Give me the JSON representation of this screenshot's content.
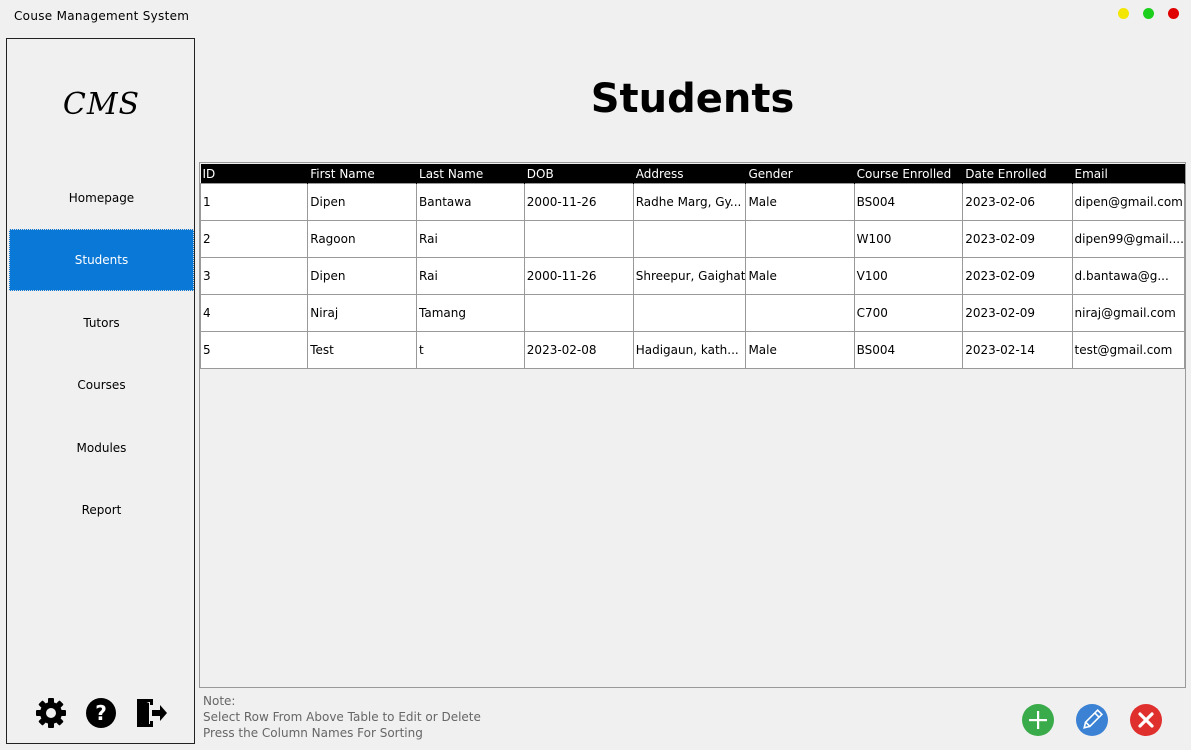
{
  "window": {
    "title": "Couse Management System"
  },
  "sidebar": {
    "logo": "CMS",
    "items": [
      {
        "label": "Homepage"
      },
      {
        "label": "Students",
        "active": true
      },
      {
        "label": "Tutors"
      },
      {
        "label": "Courses"
      },
      {
        "label": "Modules"
      },
      {
        "label": "Report"
      }
    ],
    "bottom_icons": [
      "gear-icon",
      "help-icon",
      "logout-icon"
    ]
  },
  "main": {
    "title": "Students",
    "table": {
      "columns": [
        "ID",
        "First Name",
        "Last Name",
        "DOB",
        "Address",
        "Gender",
        "Course Enrolled",
        "Date Enrolled",
        "Email"
      ],
      "rows": [
        [
          "1",
          "Dipen",
          "Bantawa",
          "2000-11-26",
          "Radhe Marg, Gy...",
          "Male",
          "BS004",
          "2023-02-06",
          "dipen@gmail.com"
        ],
        [
          "2",
          "Ragoon",
          "Rai",
          "",
          "",
          "",
          "W100",
          "2023-02-09",
          "dipen99@gmail...."
        ],
        [
          "3",
          "Dipen",
          "Rai",
          "2000-11-26",
          "Shreepur, Gaighat",
          "Male",
          "V100",
          "2023-02-09",
          "d.bantawa@g..."
        ],
        [
          "4",
          "Niraj",
          "Tamang",
          "",
          "",
          "",
          "C700",
          "2023-02-09",
          "niraj@gmail.com"
        ],
        [
          "5",
          "Test",
          "t",
          "2023-02-08",
          "Hadigaun, kath...",
          "Male",
          "BS004",
          "2023-02-14",
          "test@gmail.com"
        ]
      ]
    },
    "note": {
      "line1": "Note:",
      "line2": "Select Row From Above Table to Edit or Delete",
      "line3": "Press the Column Names For Sorting"
    },
    "actions": [
      "add-icon",
      "edit-icon",
      "delete-icon"
    ]
  },
  "colors": {
    "active_nav": "#0a78d7",
    "add": "#3aab4a",
    "edit": "#3b82d4",
    "delete": "#e0302e"
  }
}
